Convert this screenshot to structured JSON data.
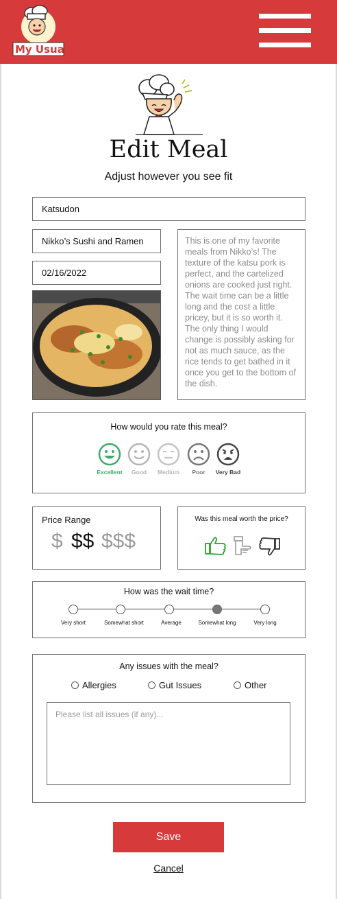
{
  "header": {
    "logo_text": "My Usual",
    "accent": "#d63a3a"
  },
  "page": {
    "title": "Edit Meal",
    "subtitle": "Adjust however you see fit"
  },
  "meal": {
    "name": "Katsudon",
    "restaurant": "Nikko’s Sushi and Ramen",
    "date": "02/16/2022",
    "notes": "This is one of my favorite meals from Nikko’s! The texture of the katsu pork is perfect, and the cartelized onions are cooked just right. The wait time can be a little long and the cost a little pricey, but it is so worth it. The only thing I would change is possibly asking for not as much sauce, as the rice tends to get bathed in it once you get to the bottom of the dish."
  },
  "rating": {
    "question": "How would you rate this meal?",
    "options": [
      "Excellent",
      "Good",
      "Medium",
      "Poor",
      "Very Bad"
    ],
    "selected": "Excellent",
    "selected_color": "#3daa6a"
  },
  "price": {
    "label": "Price Range",
    "options": [
      "$",
      "$$",
      "$$$"
    ],
    "selected": "$$"
  },
  "worth": {
    "question": "Was this meal worth the price?",
    "options": [
      "thumbs-up-icon",
      "neutral-hand-icon",
      "thumbs-down-icon"
    ],
    "selected": "thumbs-up-icon"
  },
  "wait": {
    "question": "How was the wait time?",
    "options": [
      "Very short",
      "Somewhat short",
      "Average",
      "Somewhat long",
      "Very long"
    ],
    "selected": "Somewhat long"
  },
  "issues": {
    "question": "Any issues with the meal?",
    "options": [
      "Allergies",
      "Gut Issues",
      "Other"
    ],
    "placeholder": "Please list all issues (if any)..."
  },
  "actions": {
    "save": "Save",
    "cancel": "Cancel"
  }
}
